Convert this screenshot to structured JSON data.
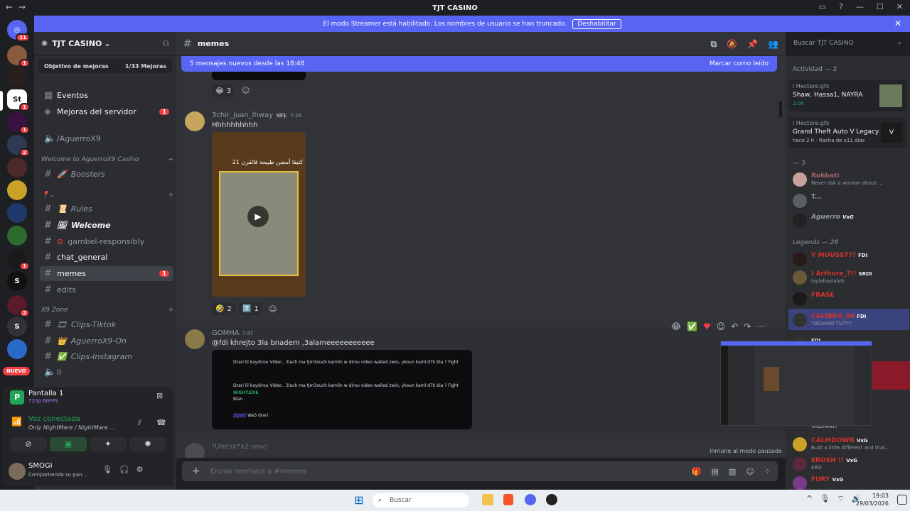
{
  "window": {
    "title": "TJT CASINO"
  },
  "streamer_banner": {
    "text": "El modo Streamer está habilitado. Los nombres de usuario se han truncado.",
    "button": "Deshabilitar"
  },
  "rail": {
    "badge_home": "11",
    "new_label": "NUEVO",
    "badges": [
      "1",
      "1",
      "1",
      "2",
      "1",
      "2"
    ]
  },
  "server": {
    "name": "TJT CASINO",
    "boost_goal": "Objetivo de mejoras",
    "boost_progress": "1/33 Mejoras"
  },
  "channels": [
    {
      "label": "Eventos",
      "icon": "calendar-icon"
    },
    {
      "label": "Mejoras del servidor",
      "count": "1"
    },
    {
      "label": "/AguerroX9"
    },
    {
      "category": "Welcome to AguerroX9 Casino"
    },
    {
      "label": "Boosters"
    },
    {
      "label": "Rules"
    },
    {
      "label": "Welcome"
    },
    {
      "label": "gambel-responsibly"
    },
    {
      "label": "chat_general"
    },
    {
      "label": "memes",
      "count": "1"
    },
    {
      "label": "edits"
    },
    {
      "category": "X9 Zone"
    },
    {
      "label": "Clips-Tiktok"
    },
    {
      "label": "AguerroX9-On"
    },
    {
      "label": "Clips-Instagram"
    },
    {
      "label": "ll"
    }
  ],
  "user_area": {
    "screen_title": "Pantalla 1",
    "screen_sub": "720p 60FPS",
    "voice_status": "Voz conectada",
    "voice_channel": "Only NightMare / NightMare ...",
    "username": "SMOGI",
    "user_status": "Compartiendo su pan..."
  },
  "header": {
    "channel": "memes",
    "search_placeholder": "Buscar TJT CASINO"
  },
  "new_messages": {
    "text": "5 mensajes nuevos desde las 18:48",
    "action": "Marcar como leído"
  },
  "messages": [
    {
      "author": "3chir_juan_lhway",
      "tag": "VF1",
      "time": "7:28",
      "text": "Hhhhhhhhhh",
      "video_caption": "كتيقا أمجنن طبيحة قالقرن 21"
    },
    {
      "author": "GOMHA",
      "time": "7:47",
      "text": "@fdi khrejto 3la bnadem ,3alameeeeeeeeeee",
      "embed_lines": [
        "Drari lil kaydirou Video , 3lach ma tjm3ouch kamlin w dirou video walled zwin, ykoun kaml d7k bla ? Fight",
        "Drari lil kaydirou Video , 3lach ma tjm3ouch kamlin w dirou video walled zwin, ykoun kaml d7k bla ? Fight",
        "Blan",
        "Wa3 drari"
      ],
      "embed_names": [
        "NIGHT.EXE",
        "zipam"
      ]
    },
    {
      "author": "!Unesx*x2",
      "tag": "DRMO"
    }
  ],
  "reactions": [
    {
      "emoji": "😂",
      "count": "3"
    },
    {
      "emoji": "🤣",
      "count": "2"
    },
    {
      "emoji": "7️⃣",
      "count": "1"
    }
  ],
  "composer": {
    "placeholder": "Enviar mensaje a #memes",
    "immune": "Inmune al modo pausado"
  },
  "members": {
    "activity_header": "Actividad — 2",
    "activity": [
      {
        "name": "l Hectore.gfx",
        "line1": "Shaw, Hassa1, NAYRA",
        "line2": "2:06"
      },
      {
        "name": "l Hectore.gfx",
        "line1": "Grand Theft Auto V Legacy",
        "line2": "hace 2 h",
        "line3": "Racha de x11 días"
      }
    ],
    "group3_header": "— 3",
    "group3": [
      {
        "name": "Rohbati",
        "status": "Never ask a woman about ..."
      },
      {
        "name": "T...",
        "status": ""
      },
      {
        "name": "Aguerro",
        "tag": "VxG"
      }
    ],
    "legends_header": "Legends — 28",
    "legends": [
      {
        "name": "Y MOUSS7??",
        "tag": "FDI",
        "status": ""
      },
      {
        "name": "I Arthure_?!!",
        "tag": "SRDI",
        "status": "laylahaylalah"
      },
      {
        "name": "FRASE",
        "status": ""
      },
      {
        "name": "CALIBRO_86",
        "tag": "FDI",
        "status": "\"ODIAMO TUTTI\""
      },
      {
        "name": "",
        "tag": "FDI",
        "status": ""
      },
      {
        "name": "VALORANT",
        "status": ""
      },
      {
        "name": "CALMDOWN",
        "tag": "VxG",
        "status": "Built a little different and that..."
      },
      {
        "name": "EROSH !!",
        "tag": "VxG",
        "status": "ERO"
      },
      {
        "name": "FURY",
        "tag": "VxG",
        "status": ""
      }
    ]
  },
  "taskbar": {
    "search": "Buscar",
    "time": "19:03",
    "date": "29/03/2026"
  },
  "colors": {
    "accent": "#5865f2",
    "red": "#f23f43",
    "green": "#23a55a"
  }
}
